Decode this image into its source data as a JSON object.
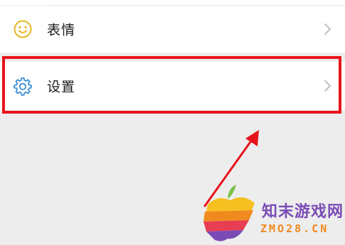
{
  "menu": {
    "items": [
      {
        "label": "表情",
        "icon": "smiley-icon",
        "icon_color": "#e6b825"
      },
      {
        "label": "设置",
        "icon": "gear-icon",
        "icon_color": "#3d8fd6"
      }
    ]
  },
  "highlight": {
    "color": "#e8141c"
  },
  "watermark": {
    "name": "知末游戏网",
    "url": "ZMO28.CN"
  }
}
